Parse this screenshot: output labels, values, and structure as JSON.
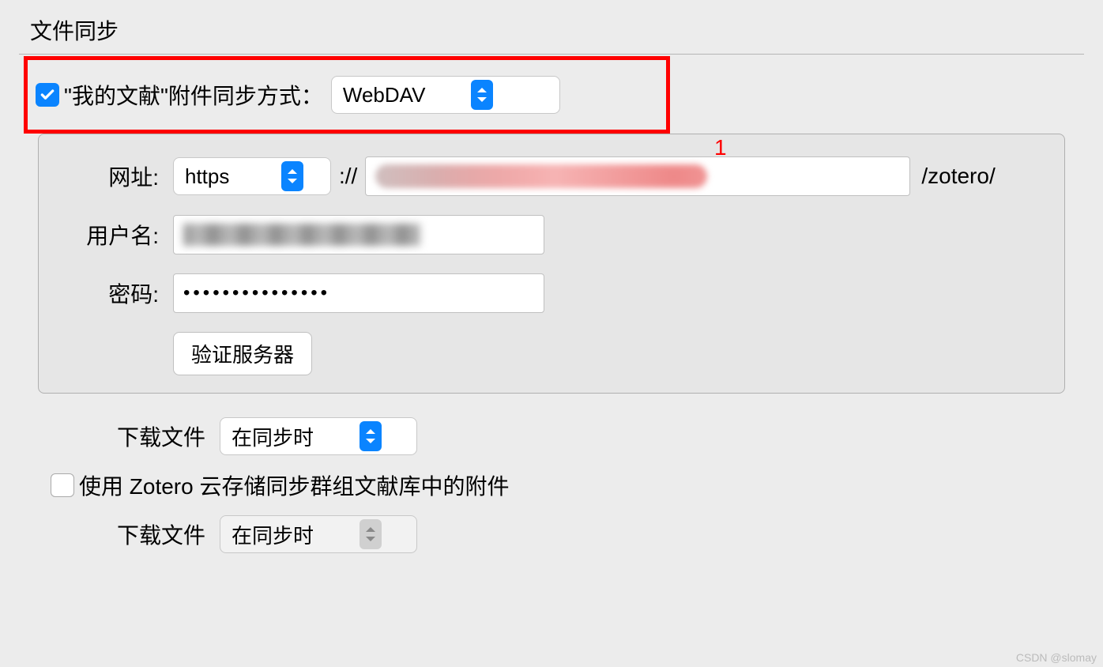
{
  "section": {
    "title": "文件同步"
  },
  "annotation": "1",
  "syncMethod": {
    "label": "\"我的文献\"附件同步方式：",
    "value": "WebDAV",
    "checked": true
  },
  "webdav": {
    "urlLabel": "网址:",
    "protocol": "https",
    "separator": "://",
    "suffix": "/zotero/",
    "usernameLabel": "用户名:",
    "passwordLabel": "密码:",
    "passwordDots": "•••••••••••••••",
    "verifyButton": "验证服务器"
  },
  "download1": {
    "label": "下载文件",
    "value": "在同步时"
  },
  "groupSync": {
    "label": "使用 Zotero 云存储同步群组文献库中的附件",
    "checked": false
  },
  "download2": {
    "label": "下载文件",
    "value": "在同步时"
  },
  "watermark": "CSDN @slomay"
}
